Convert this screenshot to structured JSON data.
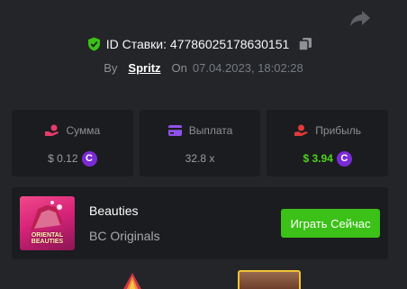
{
  "header": {
    "bet_id_label": "ID Ставки: 47786025178630151",
    "by_label": "By",
    "username": "Spritz",
    "on_label": "On",
    "date": "07.04.2023, 18:02:28"
  },
  "stats": [
    {
      "label": "Сумма",
      "value": "$ 0.12",
      "icon": "money-hand-icon",
      "has_coin": true
    },
    {
      "label": "Выплата",
      "value": "32.8 x",
      "icon": "card-icon",
      "has_coin": false
    },
    {
      "label": "Прибыль",
      "value": "$ 3.94",
      "icon": "profit-hand-icon",
      "has_coin": true
    }
  ],
  "game": {
    "title": "Beauties",
    "provider": "BC Originals",
    "thumb_text_line1": "ORIENTAL",
    "thumb_text_line2": "BEAUTIES",
    "play_label": "Играть Сейчас"
  },
  "coin_symbol": "C",
  "colors": {
    "background": "#232528",
    "card": "#1b1c1f",
    "accent_green": "#3bc117",
    "profit_green": "#4ed31b",
    "coin_purple": "#7b2bd6",
    "stat_icon_pink": "#e83a6b",
    "stat_icon_purple": "#8e52e8",
    "stat_icon_red": "#e03a3a"
  }
}
